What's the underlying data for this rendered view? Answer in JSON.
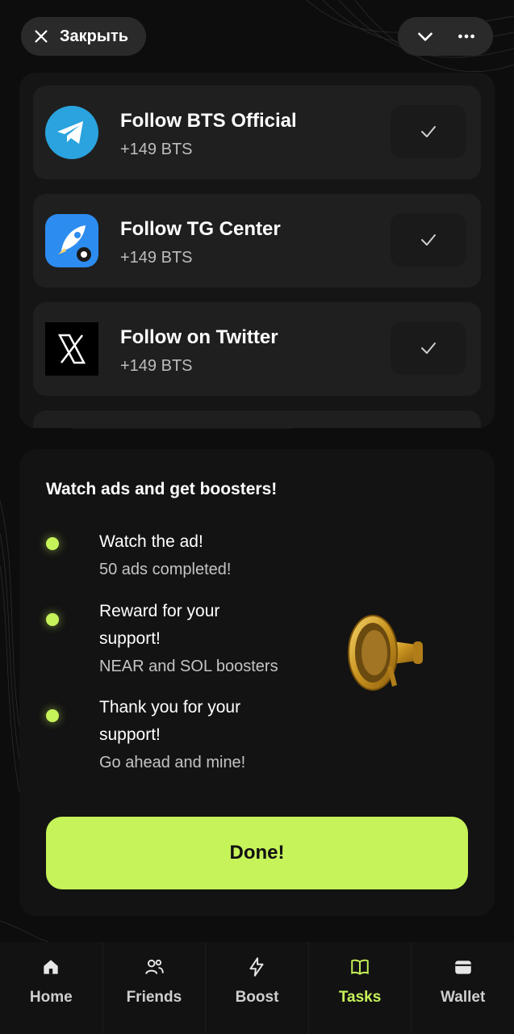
{
  "topbar": {
    "close_label": "Закрыть",
    "close_icon": "close-icon",
    "collapse_icon": "chevron-down-icon",
    "menu_icon": "more-icon"
  },
  "tasks": [
    {
      "title": "Follow BTS Official",
      "reward": "+149 BTS",
      "icon": "telegram-icon",
      "status": "done"
    },
    {
      "title": "Follow TG Center",
      "reward": "+149 BTS",
      "icon": "rocket-icon",
      "status": "done"
    },
    {
      "title": "Follow on Twitter",
      "reward": "+149 BTS",
      "icon": "x-icon",
      "status": "done"
    }
  ],
  "ads": {
    "title": "Watch ads and get boosters!",
    "steps": [
      {
        "title": "Watch the ad!",
        "subtitle": "50 ads completed!"
      },
      {
        "title": "Reward for your support!",
        "subtitle": "NEAR and SOL boosters"
      },
      {
        "title": "Thank you for your support!",
        "subtitle": "Go ahead and mine!"
      }
    ],
    "done_label": "Done!",
    "image": "megaphone-icon"
  },
  "nav": {
    "items": [
      {
        "label": "Home",
        "icon": "home-icon",
        "active": false
      },
      {
        "label": "Friends",
        "icon": "friends-icon",
        "active": false
      },
      {
        "label": "Boost",
        "icon": "lightning-icon",
        "active": false
      },
      {
        "label": "Tasks",
        "icon": "book-icon",
        "active": true
      },
      {
        "label": "Wallet",
        "icon": "wallet-icon",
        "active": false
      }
    ]
  },
  "colors": {
    "accent": "#c6f35a",
    "background": "#0d0d0d",
    "card": "#131313",
    "task_card": "#1f1f1f",
    "telegram_blue": "#2aa3df"
  }
}
